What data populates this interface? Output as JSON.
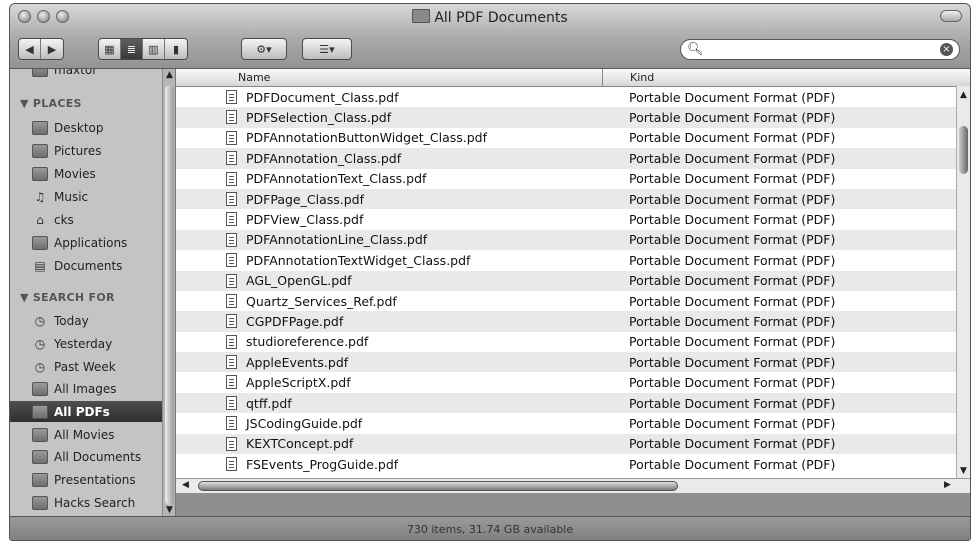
{
  "window": {
    "title": "All PDF Documents"
  },
  "toolbar": {
    "action_label": "⚙▾",
    "arrange_label": "☰▾"
  },
  "search": {
    "value": "",
    "placeholder": ""
  },
  "sidebar": {
    "top_partial": "maxtor",
    "places_header": "▼ PLACES",
    "places": [
      {
        "label": "Desktop",
        "icon": "desktop-icon"
      },
      {
        "label": "Pictures",
        "icon": "pictures-folder-icon"
      },
      {
        "label": "Movies",
        "icon": "movies-folder-icon"
      },
      {
        "label": "Music",
        "icon": "music-note-icon"
      },
      {
        "label": "cks",
        "icon": "home-icon"
      },
      {
        "label": "Applications",
        "icon": "applications-folder-icon"
      },
      {
        "label": "Documents",
        "icon": "documents-folder-icon"
      }
    ],
    "search_header": "▼ SEARCH FOR",
    "searches": [
      {
        "label": "Today",
        "icon": "clock-icon"
      },
      {
        "label": "Yesterday",
        "icon": "clock-icon"
      },
      {
        "label": "Past Week",
        "icon": "clock-icon"
      },
      {
        "label": "All Images",
        "icon": "smart-folder-icon"
      },
      {
        "label": "All PDFs",
        "icon": "smart-folder-icon",
        "selected": true
      },
      {
        "label": "All Movies",
        "icon": "smart-folder-icon"
      },
      {
        "label": "All Documents",
        "icon": "smart-folder-icon"
      },
      {
        "label": "Presentations",
        "icon": "smart-folder-icon"
      },
      {
        "label": "Hacks Search",
        "icon": "smart-folder-icon"
      }
    ]
  },
  "list": {
    "columns": [
      "Name",
      "Kind"
    ],
    "rows": [
      {
        "name": "PDFDocument_Class.pdf",
        "kind": "Portable Document Format (PDF)"
      },
      {
        "name": "PDFSelection_Class.pdf",
        "kind": "Portable Document Format (PDF)"
      },
      {
        "name": "PDFAnnotationButtonWidget_Class.pdf",
        "kind": "Portable Document Format (PDF)"
      },
      {
        "name": "PDFAnnotation_Class.pdf",
        "kind": "Portable Document Format (PDF)"
      },
      {
        "name": "PDFAnnotationText_Class.pdf",
        "kind": "Portable Document Format (PDF)"
      },
      {
        "name": "PDFPage_Class.pdf",
        "kind": "Portable Document Format (PDF)"
      },
      {
        "name": "PDFView_Class.pdf",
        "kind": "Portable Document Format (PDF)"
      },
      {
        "name": "PDFAnnotationLine_Class.pdf",
        "kind": "Portable Document Format (PDF)"
      },
      {
        "name": "PDFAnnotationTextWidget_Class.pdf",
        "kind": "Portable Document Format (PDF)"
      },
      {
        "name": "AGL_OpenGL.pdf",
        "kind": "Portable Document Format (PDF)"
      },
      {
        "name": "Quartz_Services_Ref.pdf",
        "kind": "Portable Document Format (PDF)"
      },
      {
        "name": "CGPDFPage.pdf",
        "kind": "Portable Document Format (PDF)"
      },
      {
        "name": "studioreference.pdf",
        "kind": "Portable Document Format (PDF)"
      },
      {
        "name": "AppleEvents.pdf",
        "kind": "Portable Document Format (PDF)"
      },
      {
        "name": "AppleScriptX.pdf",
        "kind": "Portable Document Format (PDF)"
      },
      {
        "name": "qtff.pdf",
        "kind": "Portable Document Format (PDF)"
      },
      {
        "name": "JSCodingGuide.pdf",
        "kind": "Portable Document Format (PDF)"
      },
      {
        "name": "KEXTConcept.pdf",
        "kind": "Portable Document Format (PDF)"
      },
      {
        "name": "FSEvents_ProgGuide.pdf",
        "kind": "Portable Document Format (PDF)"
      }
    ]
  },
  "status": {
    "text": "730 items, 31.74 GB available"
  }
}
